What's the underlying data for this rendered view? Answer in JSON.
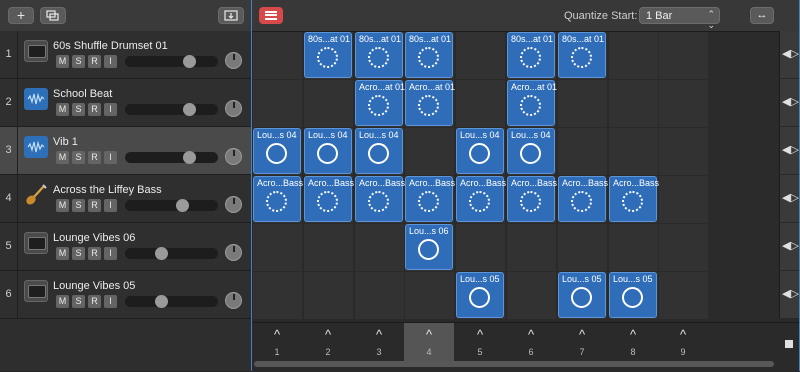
{
  "toolbar": {
    "add_icon": "plus-icon",
    "duplicate_icon": "duplicate-icon",
    "folder_icon": "folder-download-icon"
  },
  "grid_header": {
    "quantize_label": "Quantize Start:",
    "quantize_value": "1 Bar",
    "clip_button_icon": "clip-list-icon",
    "width_toggle_icon": "expand-horizontal-icon"
  },
  "tracks": [
    {
      "num": "1",
      "name": "60s Shuffle Drumset 01",
      "icon": "drum-machine-icon",
      "m": "M",
      "s": "S",
      "r": "R",
      "i": "I",
      "volume": 0.72,
      "selected": false
    },
    {
      "num": "2",
      "name": "School Beat",
      "icon": "waveform-icon",
      "m": "M",
      "s": "S",
      "r": "R",
      "i": "I",
      "volume": 0.72,
      "selected": false
    },
    {
      "num": "3",
      "name": "Vib 1",
      "icon": "waveform-icon",
      "m": "M",
      "s": "S",
      "r": "R",
      "i": "I",
      "volume": 0.72,
      "selected": true
    },
    {
      "num": "4",
      "name": "Across the Liffey Bass",
      "icon": "bass-guitar-icon",
      "m": "M",
      "s": "S",
      "r": "R",
      "i": "I",
      "volume": 0.64,
      "selected": false
    },
    {
      "num": "5",
      "name": "Lounge Vibes 06",
      "icon": "drum-machine-icon",
      "m": "M",
      "s": "S",
      "r": "R",
      "i": "I",
      "volume": 0.38,
      "selected": false
    },
    {
      "num": "6",
      "name": "Lounge Vibes 05",
      "icon": "drum-machine-icon",
      "m": "M",
      "s": "S",
      "r": "R",
      "i": "I",
      "volume": 0.38,
      "selected": false
    }
  ],
  "clips": [
    {
      "row": 0,
      "col": 1,
      "name": "80s...at 01",
      "style": "dotted"
    },
    {
      "row": 0,
      "col": 2,
      "name": "80s...at 01",
      "style": "dotted"
    },
    {
      "row": 0,
      "col": 3,
      "name": "80s...at 01",
      "style": "dotted"
    },
    {
      "row": 0,
      "col": 5,
      "name": "80s...at 01",
      "style": "dotted"
    },
    {
      "row": 0,
      "col": 6,
      "name": "80s...at 01",
      "style": "dotted"
    },
    {
      "row": 1,
      "col": 2,
      "name": "Acro...at 01",
      "style": "dotted"
    },
    {
      "row": 1,
      "col": 3,
      "name": "Acro...at 01",
      "style": "dotted"
    },
    {
      "row": 1,
      "col": 5,
      "name": "Acro...at 01",
      "style": "dotted"
    },
    {
      "row": 2,
      "col": 0,
      "name": "Lou...s 04",
      "style": "solid"
    },
    {
      "row": 2,
      "col": 1,
      "name": "Lou...s 04",
      "style": "solid"
    },
    {
      "row": 2,
      "col": 2,
      "name": "Lou...s 04",
      "style": "solid"
    },
    {
      "row": 2,
      "col": 4,
      "name": "Lou...s 04",
      "style": "solid"
    },
    {
      "row": 2,
      "col": 5,
      "name": "Lou...s 04",
      "style": "solid"
    },
    {
      "row": 3,
      "col": 0,
      "name": "Acro...Bass",
      "style": "dotted"
    },
    {
      "row": 3,
      "col": 1,
      "name": "Acro...Bass",
      "style": "dotted"
    },
    {
      "row": 3,
      "col": 2,
      "name": "Acro...Bass",
      "style": "dotted"
    },
    {
      "row": 3,
      "col": 3,
      "name": "Acro...Bass",
      "style": "dotted"
    },
    {
      "row": 3,
      "col": 4,
      "name": "Acro...Bass",
      "style": "dotted"
    },
    {
      "row": 3,
      "col": 5,
      "name": "Acro...Bass",
      "style": "dotted"
    },
    {
      "row": 3,
      "col": 6,
      "name": "Acro...Bass",
      "style": "dotted"
    },
    {
      "row": 3,
      "col": 7,
      "name": "Acro...Bass",
      "style": "dotted"
    },
    {
      "row": 4,
      "col": 3,
      "name": "Lou...s 06",
      "style": "solid"
    },
    {
      "row": 5,
      "col": 4,
      "name": "Lou...s 05",
      "style": "solid"
    },
    {
      "row": 5,
      "col": 6,
      "name": "Lou...s 05",
      "style": "solid"
    },
    {
      "row": 5,
      "col": 7,
      "name": "Lou...s 05",
      "style": "solid"
    }
  ],
  "scenes": [
    "1",
    "2",
    "3",
    "4",
    "5",
    "6",
    "7",
    "8",
    "9"
  ],
  "active_scene": 3,
  "colors": {
    "clip": "#2f6db8",
    "accent": "#4a7fc0",
    "clip_button": "#d84a4a"
  }
}
